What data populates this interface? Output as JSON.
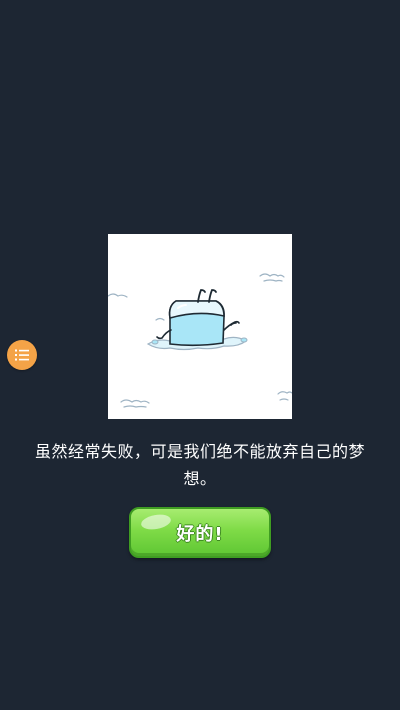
{
  "dialog": {
    "message": "虽然经常失败，可是我们绝不能放弃自己的梦想。",
    "ok_label": "好的!"
  },
  "icons": {
    "menu": "menu-list-icon",
    "illustration": "melting-ice-cube-character"
  },
  "colors": {
    "background": "#1d2633",
    "menu_button": "#f4a347",
    "ok_button": "#7fdb47",
    "ice": "#a9e6f7"
  }
}
